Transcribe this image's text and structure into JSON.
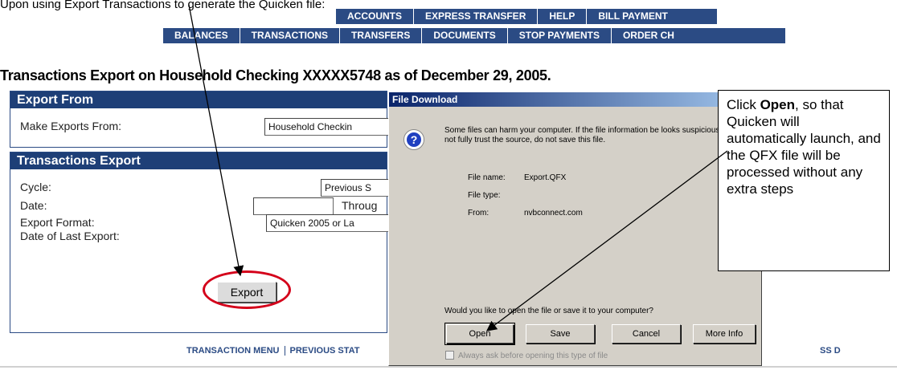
{
  "intro_text": "Upon using Export Transactions to generate the Quicken file:",
  "nav": {
    "row1": [
      "ACCOUNTS",
      "EXPRESS TRANSFER",
      "HELP",
      "BILL PAYMENT"
    ],
    "row2": [
      "BALANCES",
      "TRANSACTIONS",
      "TRANSFERS",
      "DOCUMENTS",
      "STOP PAYMENTS",
      "ORDER CH"
    ]
  },
  "page_title": "Transactions Export on Household Checking XXXXX5748 as of December 29, 2005.",
  "export_from": {
    "header": "Export From",
    "label": "Make Exports From:",
    "value": "Household Checkin"
  },
  "transactions_export": {
    "header": "Transactions Export",
    "cycle_label": "Cycle:",
    "cycle_value": "Previous S",
    "date_label": "Date:",
    "date_value": "",
    "through_label": "Throug",
    "format_label": "Export Format:",
    "format_value": "Quicken 2005 or La",
    "last_export_label": "Date of Last Export:",
    "export_button": "Export"
  },
  "bottom_links": [
    "TRANSACTION MENU",
    "PREVIOUS STAT"
  ],
  "bottom_right_fragment": "SS D",
  "dialog": {
    "title": "File Download",
    "icon": "question-icon",
    "warning": "Some files can harm your computer. If the file information be looks suspicious, or you do not fully trust the source, do not save this file.",
    "file_name_label": "File name:",
    "file_name": "Export.QFX",
    "file_type_label": "File type:",
    "file_type": "",
    "from_label": "From:",
    "from_value": "nvbconnect.com",
    "question": "Would you like to open the file or save it to your computer?",
    "buttons": {
      "open": "Open",
      "save": "Save",
      "cancel": "Cancel",
      "more_info": "More Info"
    },
    "checkbox_label": "Always ask before opening this type of file",
    "checkbox_checked": true
  },
  "callout": {
    "prefix": "Click ",
    "bold_word": "Open",
    "suffix": ", so that Quicken will automatically launch, and the QFX file will be processed without any extra steps"
  },
  "colors": {
    "nav_bg": "#2b4b84",
    "panel_header_bg": "#1e3f77",
    "highlight_ellipse": "#d4001a",
    "dialog_bg": "#d4d0c8"
  }
}
